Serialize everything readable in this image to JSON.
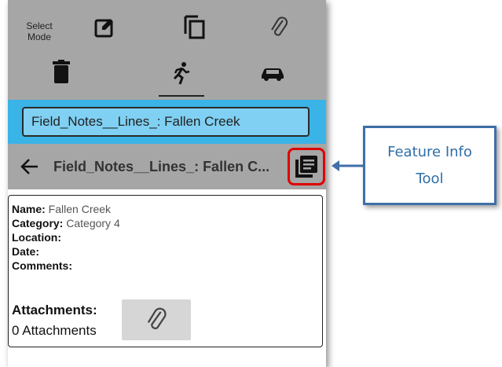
{
  "toolbar": {
    "select_mode_line1": "Select",
    "select_mode_line2": "Mode",
    "icons": [
      "edit-icon",
      "copy-icon",
      "paperclip-icon",
      "trash-icon",
      "walking-icon",
      "car-icon"
    ],
    "active_tab": "walking"
  },
  "search": {
    "value": "Field_Notes__Lines_: Fallen Creek"
  },
  "titlebar": {
    "title": "Field_Notes__Lines_: Fallen C..."
  },
  "details": {
    "fields": [
      {
        "label": "Name:",
        "value": " Fallen Creek"
      },
      {
        "label": "Category:",
        "value": " Category 4"
      },
      {
        "label": "Location:",
        "value": ""
      },
      {
        "label": "Date:",
        "value": ""
      },
      {
        "label": "Comments:",
        "value": ""
      }
    ],
    "attachments_label": "Attachments:",
    "attachments_count": "0 Attachments"
  },
  "callout": {
    "line1": "Feature Info",
    "line2": "Tool"
  },
  "colors": {
    "toolbar_bg": "#a6a6a6",
    "search_bar_bg": "#3ab3e6",
    "search_input_bg": "#7fd0f2",
    "highlight": "#e00000",
    "callout_border": "#3f6fa8",
    "callout_text": "#2f6ea8"
  }
}
